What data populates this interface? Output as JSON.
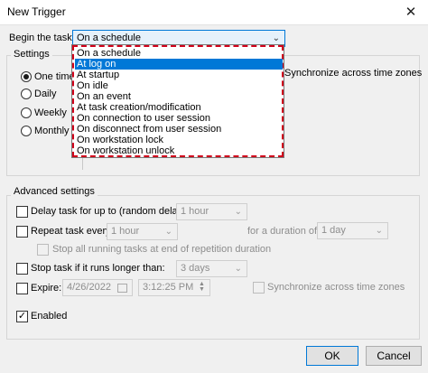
{
  "window": {
    "title": "New Trigger",
    "close_glyph": "✕"
  },
  "begin_task": {
    "label": "Begin the task:",
    "value": "On a schedule",
    "chevron": "⌄"
  },
  "settings": {
    "group_label": "Settings",
    "radios": [
      "One time",
      "Daily",
      "Weekly",
      "Monthly"
    ],
    "sync_label": "Synchronize across time zones"
  },
  "dropdown": {
    "options": [
      "On a schedule",
      "At log on",
      "At startup",
      "On idle",
      "On an event",
      "At task creation/modification",
      "On connection to user session",
      "On disconnect from user session",
      "On workstation lock",
      "On workstation unlock"
    ],
    "highlighted": "At log on",
    "annotation_color": "#d0021b"
  },
  "advanced": {
    "group_label": "Advanced settings",
    "delay": {
      "label": "Delay task for up to (random delay):",
      "value": "1 hour",
      "checked": false
    },
    "repeat": {
      "label": "Repeat task every:",
      "value": "1 hour",
      "duration_label": "for a duration of:",
      "duration_value": "1 day",
      "checked": false
    },
    "stop_running": {
      "label": "Stop all running tasks at end of repetition duration",
      "checked": false
    },
    "stop_longer": {
      "label": "Stop task if it runs longer than:",
      "value": "3 days",
      "checked": false
    },
    "expire": {
      "label": "Expire:",
      "date": "4/26/2022",
      "time": "3:12:25 PM",
      "sync_label": "Synchronize across time zones",
      "checked": false
    },
    "enabled": {
      "label": "Enabled",
      "checked": true,
      "mark": "✓"
    }
  },
  "buttons": {
    "ok": "OK",
    "cancel": "Cancel"
  },
  "colors": {
    "accent": "#0078d7",
    "highlight_text": "#ffffff",
    "dialog_bg": "#f0f0f0"
  }
}
